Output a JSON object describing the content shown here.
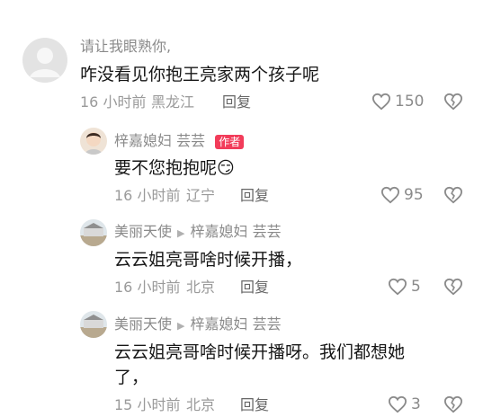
{
  "comments": [
    {
      "author": "请让我眼熟你,",
      "text": "咋没看见你抱王亮家两个孩子呢",
      "time": "16 小时前",
      "location": "黑龙江",
      "reply_label": "回复",
      "likes": "150",
      "avatar_color": "#d9d9d9"
    },
    {
      "author": "梓嘉媳妇 芸芸",
      "badge": "作者",
      "text": "要不您抱抱呢",
      "emoji": "😏",
      "time": "16 小时前",
      "location": "辽宁",
      "reply_label": "回复",
      "likes": "95",
      "avatar_color": "#e7d7c9"
    },
    {
      "author": "美丽天使",
      "reply_to": "梓嘉媳妇 芸芸",
      "text": "云云姐亮哥啥时候开播，",
      "time": "16 小时前",
      "location": "北京",
      "reply_label": "回复",
      "likes": "5",
      "avatar_color": "#cfd6da"
    },
    {
      "author": "美丽天使",
      "reply_to": "梓嘉媳妇 芸芸",
      "text_line1": "云云姐亮哥啥时候开播呀。我们都想她",
      "text_line2": "了，",
      "time": "15 小时前",
      "location": "北京",
      "reply_label": "回复",
      "likes": "3",
      "avatar_color": "#cfd6da"
    }
  ],
  "colors": {
    "accent": "#f23c5a",
    "text": "#161616",
    "meta": "#9a9a9a"
  },
  "icons": [
    "heart-icon",
    "dislike-heart-icon",
    "play-arrow-icon"
  ]
}
